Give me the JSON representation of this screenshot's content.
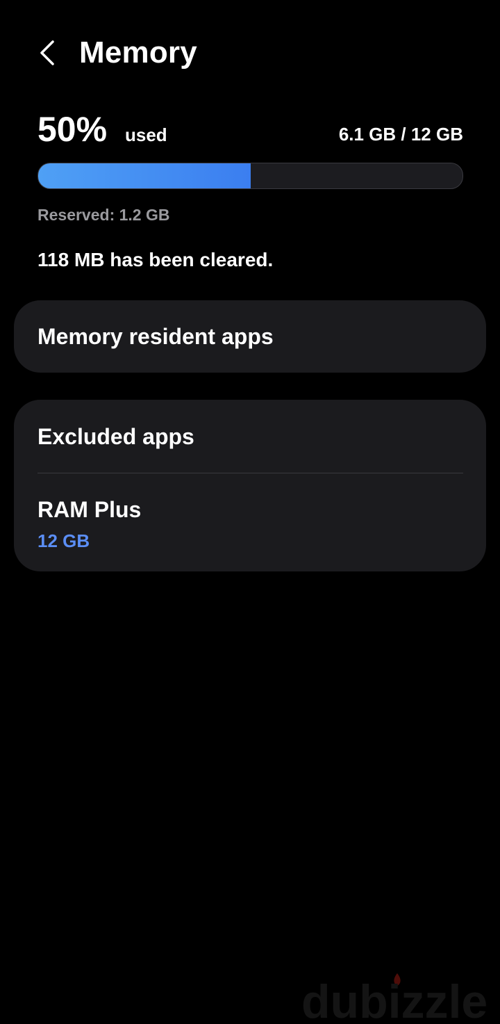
{
  "header": {
    "title": "Memory",
    "back_icon": "chevron-left-icon"
  },
  "usage": {
    "percent_label": "50%",
    "used_label": "used",
    "amount": "6.1 GB / 12 GB",
    "progress_fraction": 0.5,
    "reserved": "Reserved: 1.2 GB",
    "cleared_message": "118 MB has been cleared."
  },
  "menu": {
    "memory_resident_apps": "Memory resident apps",
    "excluded_apps": "Excluded apps",
    "ram_plus_label": "RAM Plus",
    "ram_plus_value": "12 GB"
  },
  "colors": {
    "background": "#000000",
    "card": "#1b1b1e",
    "accent_blue": "#5b8ef5",
    "progress_blue": "#3b7ef0"
  },
  "watermark": {
    "text": "dubizzle"
  }
}
